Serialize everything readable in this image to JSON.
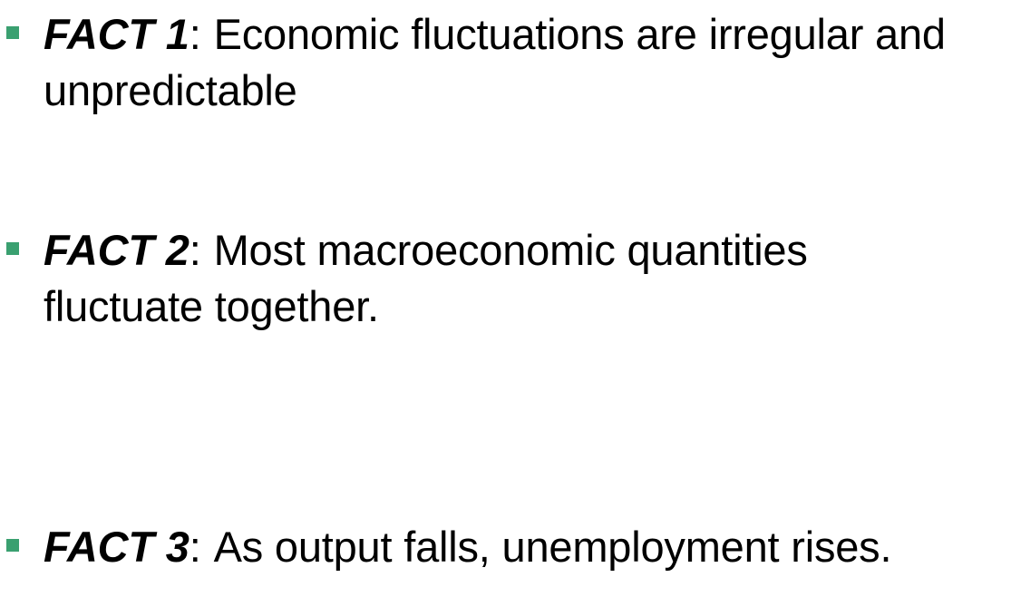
{
  "facts": [
    {
      "label": "FACT 1",
      "colon": ":",
      "line1": "Economic fluctuations are irregular and",
      "line2": "unpredictable"
    },
    {
      "label": "FACT 2",
      "colon": ":",
      "line1": "Most macroeconomic quantities",
      "line2": "fluctuate together."
    },
    {
      "label": "FACT 3",
      "colon": ":",
      "line1": "As output falls, unemployment rises."
    }
  ],
  "colors": {
    "bullet": "#3aa070",
    "text": "#000000"
  },
  "icons": {
    "bullet": "square-bullet-icon"
  }
}
